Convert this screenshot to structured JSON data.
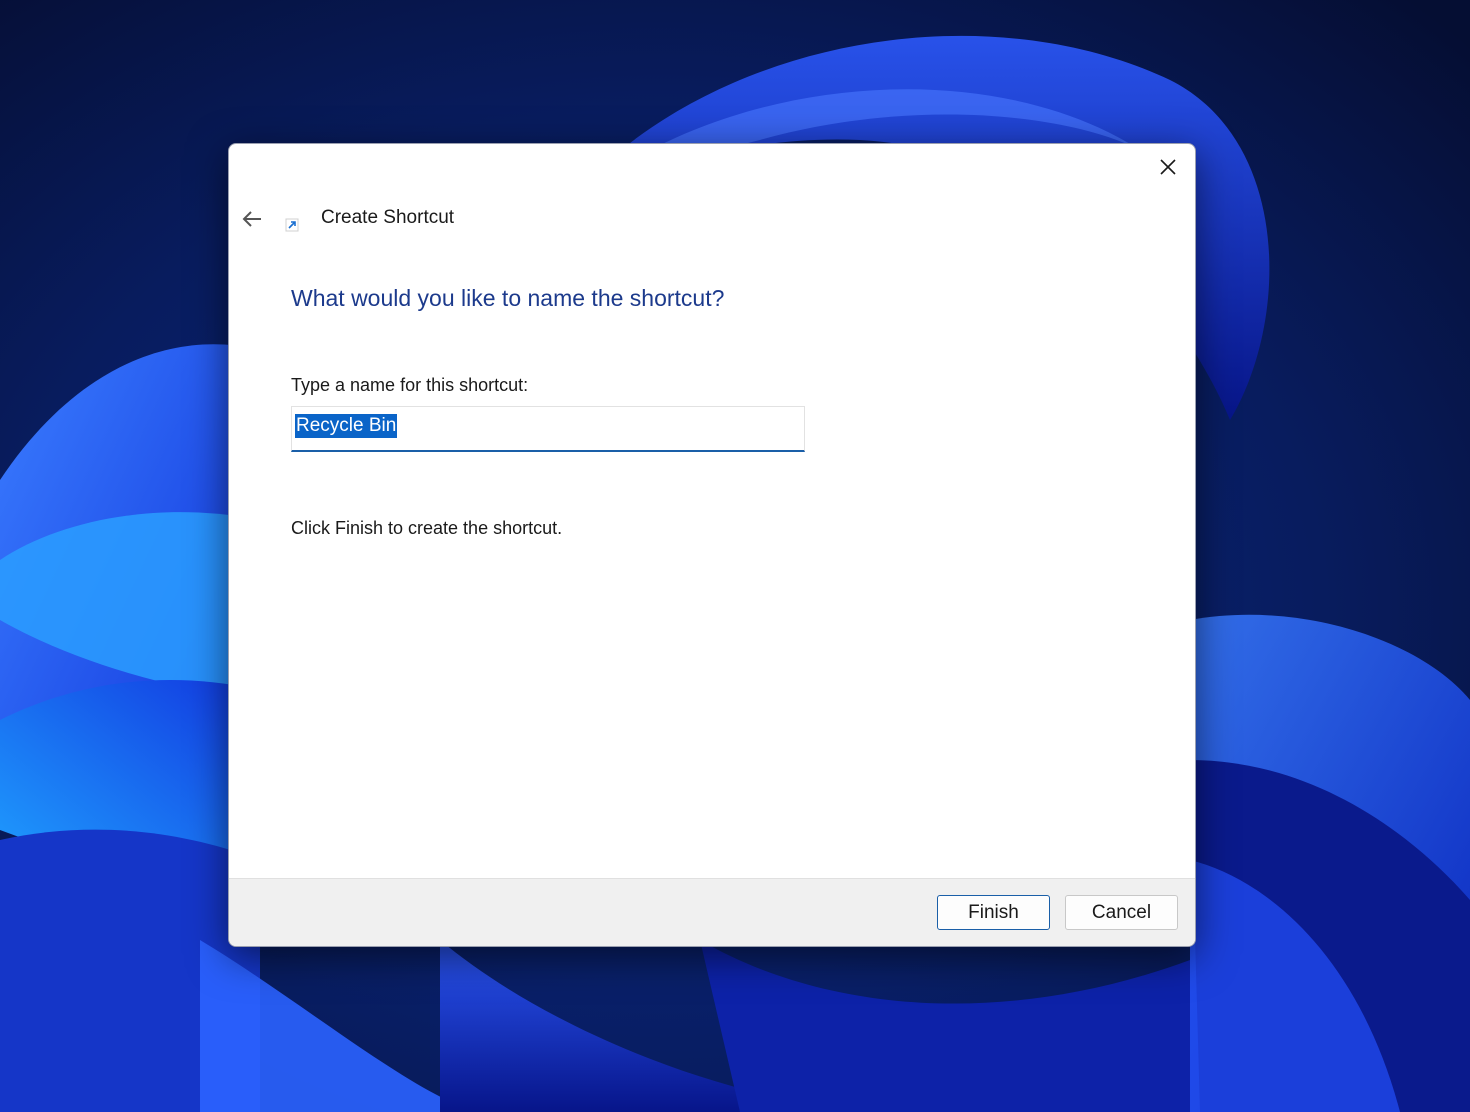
{
  "wizard": {
    "title": "Create Shortcut",
    "heading": "What would you like to name the shortcut?",
    "name_label": "Type a name for this shortcut:",
    "name_value": "Recycle Bin",
    "instruction": "Click Finish to create the shortcut."
  },
  "buttons": {
    "finish_label": "Finish",
    "cancel_label": "Cancel"
  },
  "icons": {
    "back": "arrow-left-icon",
    "close": "close-icon",
    "wizard": "shortcut-arrow-icon"
  },
  "colors": {
    "heading": "#1c3a8c",
    "selection": "#0a64c8",
    "accent_border": "#1a5fa8",
    "footer_bg": "#f0f0f0"
  }
}
